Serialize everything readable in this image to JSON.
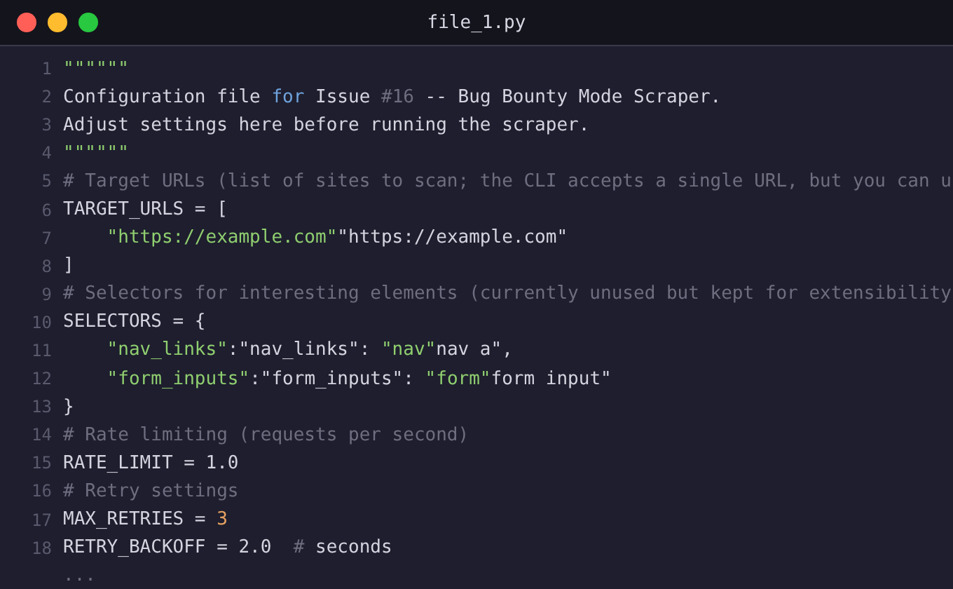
{
  "window": {
    "title": "file_1.py",
    "buttons": [
      {
        "kind": "close"
      },
      {
        "kind": "minimize"
      },
      {
        "kind": "zoom"
      }
    ]
  },
  "lines": [
    {
      "number": "1",
      "tokens": [
        {
          "kind": "string",
          "text": "\"\"\"\"\"\""
        }
      ]
    },
    {
      "number": "2",
      "tokens": [
        {
          "kind": "plain",
          "text": "Configuration file "
        },
        {
          "kind": "keyword",
          "text": "for"
        },
        {
          "kind": "plain",
          "text": " Issue "
        },
        {
          "kind": "comment",
          "text": "#16"
        },
        {
          "kind": "plain",
          "text": " -- Bug Bounty Mode Scraper."
        }
      ]
    },
    {
      "number": "3",
      "tokens": [
        {
          "kind": "plain",
          "text": "Adjust settings here before running the scraper."
        }
      ]
    },
    {
      "number": "4",
      "tokens": [
        {
          "kind": "string",
          "text": "\"\"\"\"\"\""
        }
      ]
    },
    {
      "number": "5",
      "tokens": [
        {
          "kind": "comment",
          "text": "# Target URLs (list of sites to scan; the CLI accepts a single URL, but you can u"
        }
      ]
    },
    {
      "number": "6",
      "tokens": [
        {
          "kind": "plain",
          "text": "TARGET_URLS = ["
        }
      ]
    },
    {
      "number": "7",
      "tokens": [
        {
          "kind": "string",
          "text": "    \"https://example.com\""
        },
        {
          "kind": "plain",
          "text": "\"https://example.com\""
        }
      ]
    },
    {
      "number": "8",
      "tokens": [
        {
          "kind": "plain",
          "text": "]"
        }
      ]
    },
    {
      "number": "9",
      "tokens": [
        {
          "kind": "comment",
          "text": "# Selectors for interesting elements (currently unused but kept for extensibility"
        }
      ]
    },
    {
      "number": "10",
      "tokens": [
        {
          "kind": "plain",
          "text": "SELECTORS = {"
        }
      ]
    },
    {
      "number": "11",
      "tokens": [
        {
          "kind": "string",
          "text": "    \"nav_links\""
        },
        {
          "kind": "plain",
          "text": ":\"nav_links\": "
        },
        {
          "kind": "string",
          "text": "\"nav\""
        },
        {
          "kind": "plain",
          "text": "nav a\","
        }
      ]
    },
    {
      "number": "12",
      "tokens": [
        {
          "kind": "string",
          "text": "    \"form_inputs\""
        },
        {
          "kind": "plain",
          "text": ":\"form_inputs\": "
        },
        {
          "kind": "string",
          "text": "\"form\""
        },
        {
          "kind": "plain",
          "text": "form input\""
        }
      ]
    },
    {
      "number": "13",
      "tokens": [
        {
          "kind": "plain",
          "text": "}"
        }
      ]
    },
    {
      "number": "14",
      "tokens": [
        {
          "kind": "comment",
          "text": "# Rate limiting (requests per second)"
        }
      ]
    },
    {
      "number": "15",
      "tokens": [
        {
          "kind": "plain",
          "text": "RATE_LIMIT = 1.0"
        }
      ]
    },
    {
      "number": "16",
      "tokens": [
        {
          "kind": "comment",
          "text": "# Retry settings"
        }
      ]
    },
    {
      "number": "17",
      "tokens": [
        {
          "kind": "plain",
          "text": "MAX_RETRIES = "
        },
        {
          "kind": "number",
          "text": "3"
        }
      ]
    },
    {
      "number": "18",
      "tokens": [
        {
          "kind": "plain",
          "text": "RETRY_BACKOFF = 2.0  "
        },
        {
          "kind": "comment",
          "text": "#"
        },
        {
          "kind": "plain",
          "text": " seconds"
        }
      ]
    },
    {
      "tokens": [
        {
          "kind": "comment",
          "text": "..."
        }
      ]
    }
  ]
}
